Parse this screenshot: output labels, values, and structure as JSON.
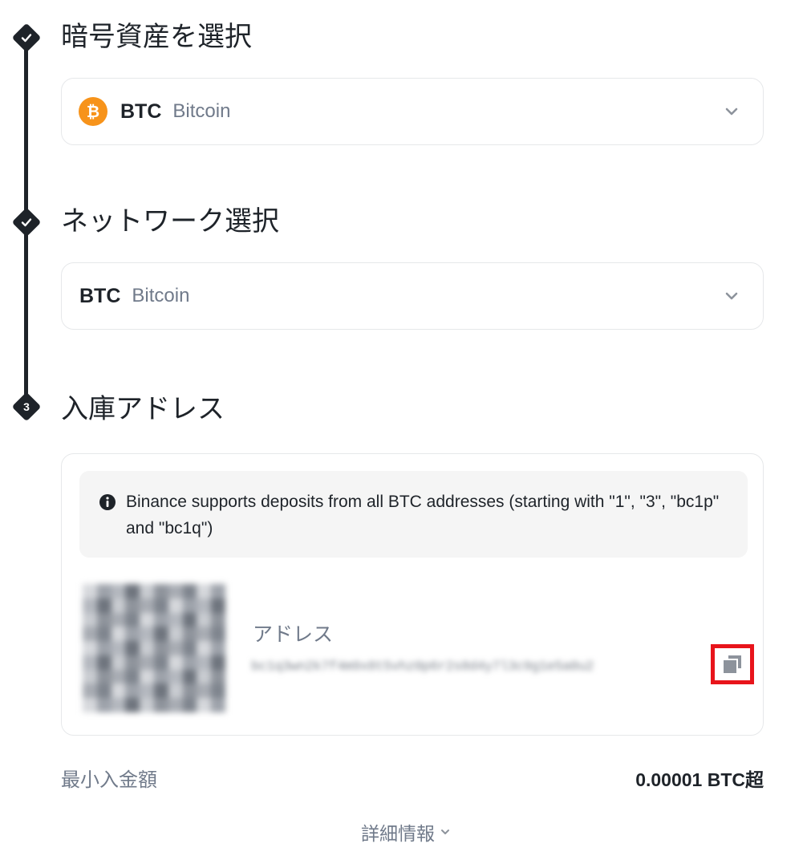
{
  "steps": [
    {
      "title": "暗号資産を選択",
      "marker": "check-icon"
    },
    {
      "title": "ネットワーク選択",
      "marker": "check-icon"
    },
    {
      "title": "入庫アドレス",
      "marker": "3"
    }
  ],
  "coin_select": {
    "icon": "bitcoin-icon",
    "icon_glyph": "₿",
    "icon_color": "#f7931a",
    "symbol": "BTC",
    "name": "Bitcoin"
  },
  "network_select": {
    "symbol": "BTC",
    "name": "Bitcoin"
  },
  "deposit": {
    "notice": "Binance supports deposits from all BTC addresses (starting with \"1\", \"3\", \"bc1p\" and \"bc1q\")",
    "address_label": "アドレス",
    "address_value": "bc1q3wn2k7f4m9x8t5vhz0p6r2s8d4y7l3c9g1e5a0u2",
    "copy_icon": "copy-icon",
    "highlight_color": "#e8141b"
  },
  "min_deposit": {
    "label": "最小入金額",
    "value": "0.00001 BTC超"
  },
  "more_info": {
    "label": "詳細情報"
  }
}
